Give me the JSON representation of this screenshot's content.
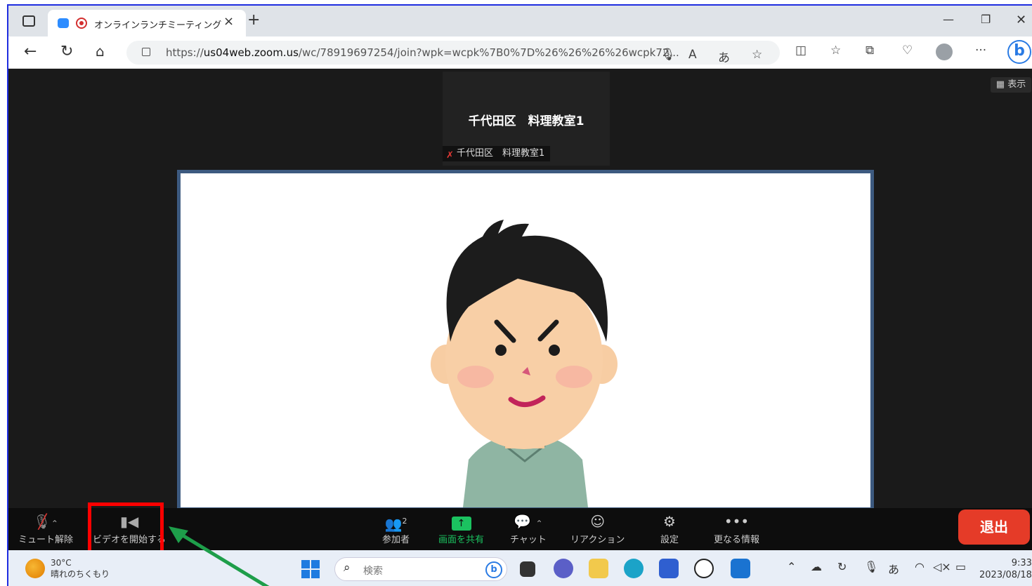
{
  "browser": {
    "tab_title": "オンラインランチミーティング",
    "url_prefix": "https://",
    "url_host": "us04web.zoom.us",
    "url_path": "/wc/78919697254/join?wpk=wcpk%7B0%7D%26%26%26%26wcpk72..."
  },
  "meeting": {
    "tile_name": "千代田区　料理教室1",
    "tile_tag": "千代田区　料理教室1",
    "view_label": "表示"
  },
  "toolbar": {
    "unmute": "ミュート解除",
    "start_video": "ビデオを開始する",
    "participants": "参加者",
    "participants_count": "2",
    "share_screen": "画面を共有",
    "chat": "チャット",
    "reaction": "リアクション",
    "settings": "設定",
    "more": "更なる情報",
    "leave": "退出"
  },
  "taskbar": {
    "temp": "30°C",
    "weather": "晴れのちくもり",
    "search_placeholder": "検索",
    "time": "9:33",
    "date": "2023/08/18",
    "ime": "あ"
  },
  "colors": {
    "leave": "#e53b28",
    "share_green": "#1bc260",
    "highlight_red": "#ff0000",
    "arrow_green": "#1e9e4a"
  }
}
